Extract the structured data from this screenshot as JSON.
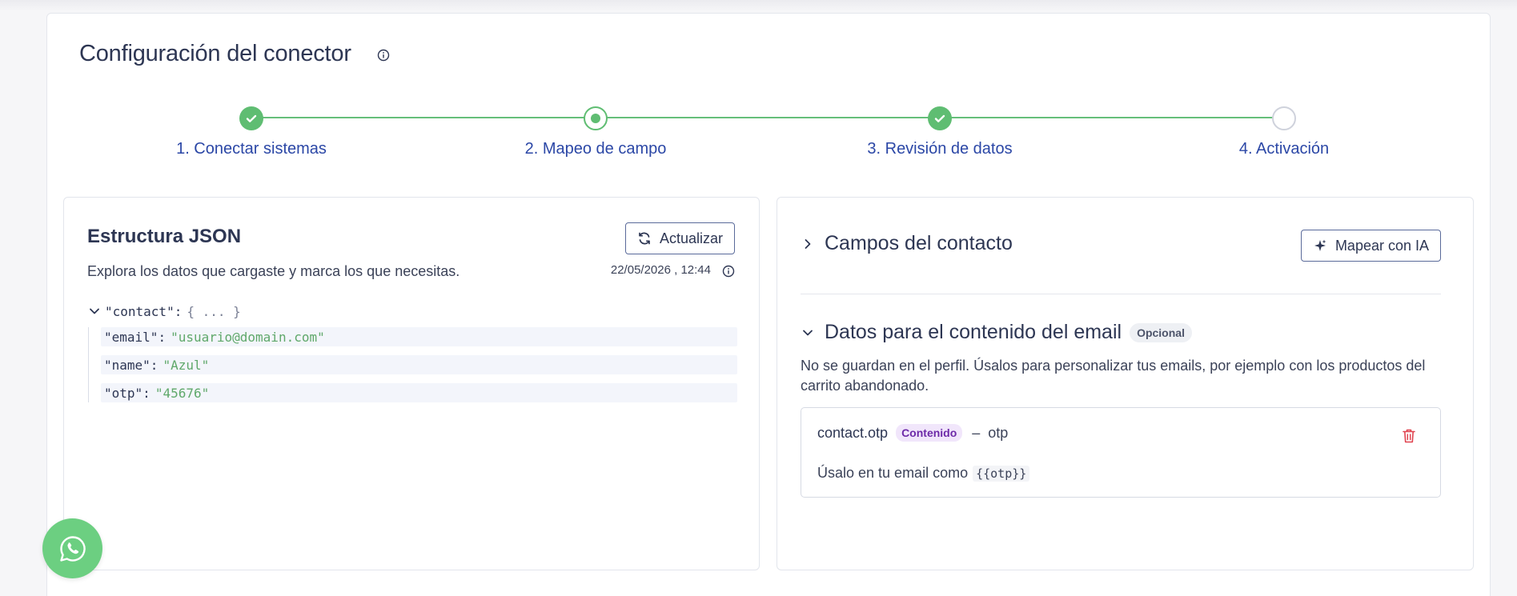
{
  "page": {
    "title": "Configuración del conector"
  },
  "stepper": {
    "steps": [
      {
        "label": "1. Conectar sistemas",
        "state": "done"
      },
      {
        "label": "2. Mapeo de campo",
        "state": "current"
      },
      {
        "label": "3. Revisión de datos",
        "state": "done"
      },
      {
        "label": "4. Activación",
        "state": "pending"
      }
    ]
  },
  "json_panel": {
    "title": "Estructura JSON",
    "refresh_label": "Actualizar",
    "subtitle": "Explora los datos que cargaste y marca los que necesitas.",
    "timestamp": "22/05/2026 , 12:44",
    "tree": {
      "root_key": "\"contact\"",
      "root_collapsed": "{ ... }",
      "children": [
        {
          "key": "\"email\"",
          "value": "\"usuario@domain.com\""
        },
        {
          "key": "\"name\"",
          "value": "\"Azul\""
        },
        {
          "key": "\"otp\"",
          "value": "\"45676\""
        }
      ]
    }
  },
  "mapping_panel": {
    "contact_fields_title": "Campos del contacto",
    "ai_map_label": "Mapear con IA",
    "email_data_title": "Datos para el contenido del email",
    "optional_badge": "Opcional",
    "description": "No se guardan en el perfil. Úsalos para personalizar tus emails, por ejemplo con los productos del carrito abandonado.",
    "field": {
      "name": "contact.otp",
      "badge": "Contenido",
      "dash": "–",
      "alias": "otp",
      "usage_text": "Úsalo en tu email como",
      "usage_code": "{{otp}}"
    }
  },
  "colors": {
    "accent_green": "#5fbd72",
    "step_label": "#2b47a6",
    "badge_purple": "#6d2aa8",
    "delete_red": "#e0434f"
  },
  "icons": {
    "title_info": "info-icon",
    "refresh": "refresh-icon",
    "ai": "sparkle-icon",
    "delete": "trash-icon",
    "chat": "whatsapp-icon"
  }
}
